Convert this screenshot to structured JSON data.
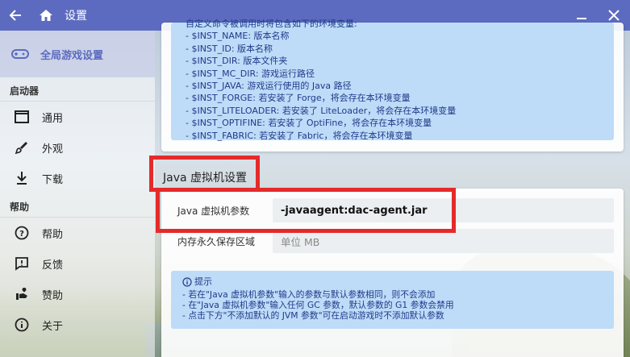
{
  "titlebar": {
    "title": "设置",
    "back_icon": "arrow-left-icon",
    "home_icon": "home-icon",
    "minimize_icon": "minimize-icon",
    "close_icon": "close-icon"
  },
  "sidebar": {
    "global_item": {
      "label": "全局游戏设置",
      "icon": "gamepad-icon"
    },
    "sections": [
      {
        "label": "启动器",
        "items": [
          {
            "label": "通用",
            "icon": "window-icon"
          },
          {
            "label": "外观",
            "icon": "brush-icon"
          },
          {
            "label": "下载",
            "icon": "download-icon"
          }
        ]
      },
      {
        "label": "帮助",
        "items": [
          {
            "label": "帮助",
            "icon": "help-icon"
          },
          {
            "label": "反馈",
            "icon": "feedback-icon"
          },
          {
            "label": "赞助",
            "icon": "sponsor-icon"
          },
          {
            "label": "关于",
            "icon": "info-icon"
          }
        ]
      }
    ]
  },
  "env_info": {
    "head": "自定义命令被调用时将包含如下的环境变量:",
    "lines": [
      "- $INST_NAME: 版本名称",
      "- $INST_ID: 版本名称",
      "- $INST_DIR: 版本文件夹",
      "- $INST_MC_DIR: 游戏运行路径",
      "- $INST_JAVA: 游戏运行使用的 Java 路径",
      "- $INST_FORGE: 若安装了 Forge，将会存在本环境变量",
      "- $INST_LITELOADER: 若安装了 LiteLoader，将会存在本环境变量",
      "- $INST_OPTIFINE: 若安装了 OptiFine，将会存在本环境变量",
      "- $INST_FABRIC: 若安装了 Fabric，将会存在本环境变量"
    ]
  },
  "java_section": {
    "title": "Java 虚拟机设置",
    "jvm_args": {
      "label": "Java 虚拟机参数",
      "value": "-javaagent:dac-agent.jar"
    },
    "perm_space": {
      "label": "内存永久保存区域",
      "placeholder": "单位 MB"
    },
    "tip": {
      "head": "提示",
      "lines": [
        "- 若在\"Java 虚拟机参数\"输入的参数与默认参数相同，则不会添加",
        "- 在\"Java 虚拟机参数\"输入任何 GC 参数，默认参数的 G1 参数会禁用",
        "- 点击下方\"不添加默认的 JVM 参数\"可在启动游戏时不添加默认参数"
      ]
    }
  },
  "colors": {
    "accent": "#5c6bc0",
    "info_bg": "#bedcf8",
    "info_text": "#1f3a8a",
    "highlight": "#e52a2a"
  }
}
